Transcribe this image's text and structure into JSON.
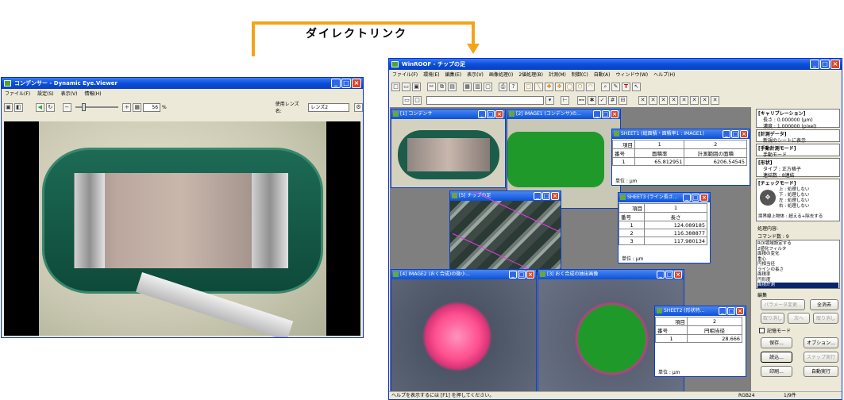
{
  "connector": {
    "label": "ダイレクトリンク",
    "color": "#f2a51a"
  },
  "left_window": {
    "title": "コンデンサー - Dynamic Eye.Viewer",
    "menu": [
      "ファイル(F)",
      "設定(S)",
      "表示(V)",
      "情報(H)"
    ],
    "zoom_value": "56",
    "zoom_unit": "%",
    "lens_label": "使用レンズ名:",
    "lens_value": "レンズ2"
  },
  "right_window": {
    "title": "WinROOF - チップの足",
    "menu": [
      "ファイル(F)",
      "環境(E)",
      "編集(E)",
      "表示(V)",
      "画像処理(I)",
      "2値処理(B)",
      "計測(M)",
      "制御(C)",
      "自動(A)",
      "ウィンドウ(W)",
      "ヘルプ(H)"
    ],
    "status_text": "ヘルプを表示するには [F1] を押してください。",
    "status_mode": "RGB24",
    "status_page": "1/9件",
    "subwindows": {
      "img1": "[1] コンデンサ",
      "img2": "[2] IMAGE1 (コンデンサ)の...",
      "img5": "[5] チップの足",
      "img4": "[4] IMAGE2 (おく合成)の微小...",
      "img3": "[3] おく合成の抽出画像",
      "sheet1": {
        "title": "SHEET1 (総面積・面積率1 : IMAGE1)",
        "head_item": "項目",
        "head_num": "番号",
        "col1_num": "1",
        "col1_name": "面積率",
        "col2_num": "2",
        "col2_name": "計測範囲の面積",
        "row": "1",
        "val1": "65.812951",
        "val2": "6206.54545",
        "unit": "単位 : μm"
      },
      "sheet3": {
        "title": "SHEET3 (ライン長さ...",
        "head_item": "項目",
        "head_num": "番号",
        "col_num": "1",
        "col_name": "長さ",
        "rows": [
          [
            "1",
            "124.089185"
          ],
          [
            "2",
            "116.388877"
          ],
          [
            "3",
            "117.980134"
          ]
        ],
        "unit": "単位 : μm"
      },
      "sheet2": {
        "title": "SHEET2 (形状特...",
        "head_item": "項目",
        "head_num": "番号",
        "col_num": "2",
        "col_name": "円相当径",
        "row": "1",
        "val": "28.666",
        "unit": "単位 : μm"
      }
    },
    "side_panel": {
      "calib_head": "[キャリブレーション]",
      "calib_line1": "長さ : 0.000000 (μm)",
      "calib_line2": "濃度 : 1.000000 (pixel)",
      "data_head": "[計測データ]",
      "data_line": "新規のシートに表示",
      "manual_head": "[手動計測モード]",
      "manual_line": "手動モード",
      "cursor_head": "[形状]",
      "cursor_line1": "タイプ : 正方格子",
      "cursor_line2": "連結数 : 8連結",
      "check_head": "[チェックモード]",
      "check_lines": [
        "上 : 処理しない",
        "下 : 処理しない",
        "左 : 処理しない",
        "右 : 処理しない",
        "境界線上物体 : 超える+除去する"
      ],
      "proc_label": "処理内容:",
      "command_label": "コマンド数 : 9",
      "proc_items": [
        "ROI領域設定する",
        "2値化フィルタ",
        "面積の変化",
        "重心",
        "円相当径",
        "ラインの長さ",
        "面積率",
        "円形度",
        "面積計測"
      ],
      "edit_label": "編集",
      "buttons": {
        "parameter": "パラメータ変更...",
        "delete_all": "全消去",
        "undo": "取り消し",
        "next": "次へ",
        "reset": "取り消し",
        "record_mode": "記憶モード",
        "save": "保存...",
        "option": "オプション...",
        "load": "読込...",
        "step": "ステップ実行",
        "print": "印刷...",
        "auto_run": "自動実行"
      }
    }
  }
}
